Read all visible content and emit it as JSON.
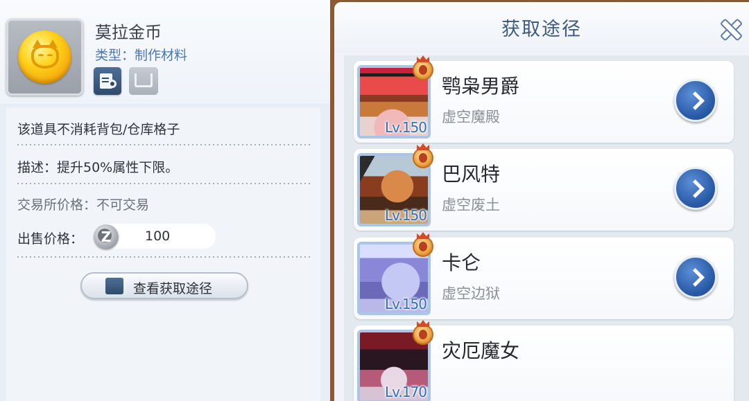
{
  "item": {
    "name": "莫拉金币",
    "type": "类型：制作材料",
    "bag_note": "该道具不消耗背包/仓库格子",
    "description": "描述：提升50%属性下限。",
    "trade": "交易所价格：不可交易",
    "sell_label": "出售价格：",
    "sell_currency_symbol": "Z",
    "sell_value": "100",
    "source_button": "查看获取途径"
  },
  "dialog": {
    "title": "获取途径",
    "sources": [
      {
        "name": "鹗枭男爵",
        "map": "虚空魔殿",
        "level": "Lv.150",
        "portrait": "baron-owl-portrait"
      },
      {
        "name": "巴风特",
        "map": "虚空废土",
        "level": "Lv.150",
        "portrait": "baphomet-portrait"
      },
      {
        "name": "卡仑",
        "map": "虚空边狱",
        "level": "Lv.150",
        "portrait": "karon-wolf-portrait"
      },
      {
        "name": "灾厄魔女",
        "map": "",
        "level": "Lv.170",
        "portrait": "calamity-witch-portrait"
      }
    ]
  },
  "colors": {
    "accent_blue": "#2a5aa7",
    "title_blue": "#3d5a80",
    "type_blue": "#4a78b8",
    "level_blue": "#2f6fb8"
  }
}
